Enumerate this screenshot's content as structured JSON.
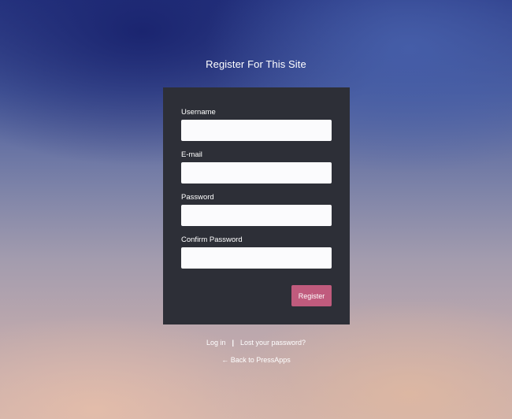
{
  "page": {
    "title": "Register For This Site"
  },
  "form": {
    "fields": [
      {
        "label": "Username",
        "value": ""
      },
      {
        "label": "E-mail",
        "value": ""
      },
      {
        "label": "Password",
        "value": ""
      },
      {
        "label": "Confirm Password",
        "value": ""
      }
    ],
    "submit_label": "Register"
  },
  "links": {
    "login": "Log in",
    "separator": "|",
    "lost_password": "Lost your password?",
    "back": "← Back to PressApps"
  },
  "colors": {
    "panel": "#2d2f37",
    "button": "#c05b7d",
    "text": "#ffffff"
  }
}
